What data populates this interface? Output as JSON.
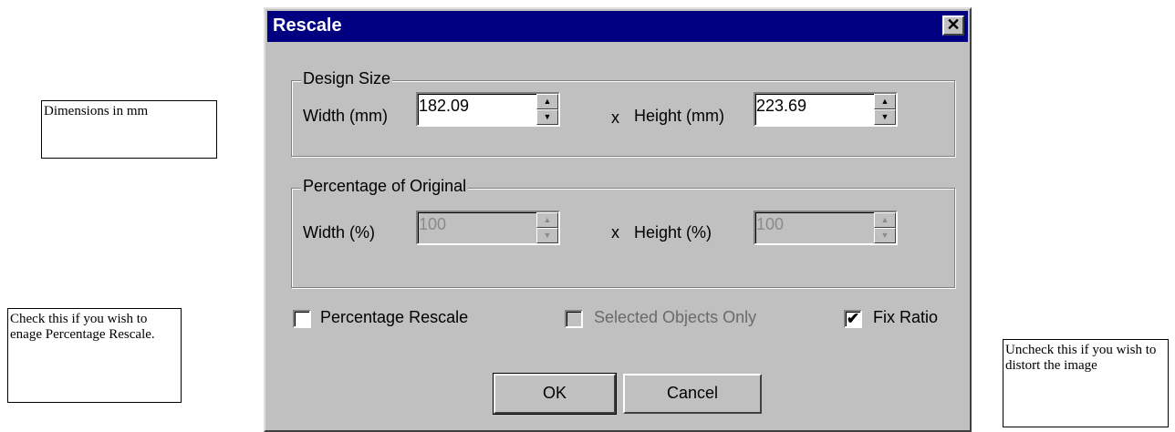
{
  "notes": {
    "dimensions": "Dimensions in mm",
    "percentage": "Check this if you wish to enage Percentage Rescale.",
    "ratio": "Uncheck this if you wish to distort the image"
  },
  "dialog": {
    "title": "Rescale",
    "close_glyph": "✕",
    "design_size": {
      "legend": "Design Size",
      "width_label": "Width (mm)",
      "width_value": "182.09",
      "x_label": "x",
      "height_label": "Height (mm)",
      "height_value": "223.69"
    },
    "percentage": {
      "legend": "Percentage of Original",
      "width_label": "Width (%)",
      "width_value": "100",
      "x_label": "x",
      "height_label": "Height (%)",
      "height_value": "100"
    },
    "options": {
      "percentage_rescale": "Percentage Rescale",
      "percentage_rescale_checked": false,
      "selected_only": "Selected Objects Only",
      "selected_only_checked": false,
      "fix_ratio": "Fix Ratio",
      "fix_ratio_checked": true,
      "check_glyph": "✔"
    },
    "buttons": {
      "ok": "OK",
      "cancel": "Cancel"
    },
    "spin_up_glyph": "▲",
    "spin_down_glyph": "▼"
  }
}
